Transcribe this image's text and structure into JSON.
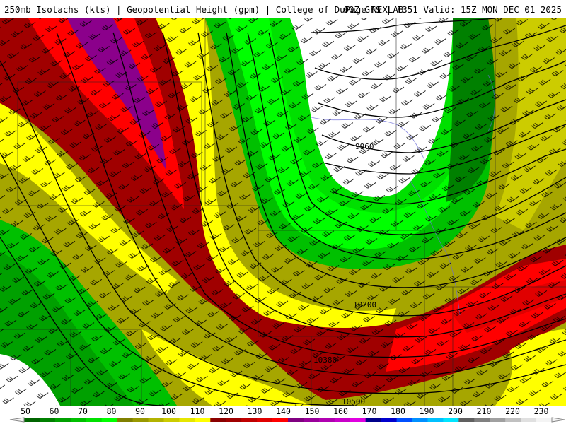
{
  "header": {
    "left": "250mb Isotachs (kts) | Geopotential Height (gpm) | College of DuPage NEXLAB",
    "right": "00Z GFS | F351 Valid: 15Z MON DEC 01 2025"
  },
  "contour_labels": [
    "9960",
    "10200",
    "10380",
    "10500"
  ],
  "legend": {
    "ticks": [
      "50",
      "60",
      "70",
      "80",
      "90",
      "100",
      "110",
      "120",
      "130",
      "140",
      "150",
      "160",
      "170",
      "180",
      "190",
      "200",
      "210",
      "220",
      "230"
    ],
    "colors": [
      "#006400",
      "#008000",
      "#00a000",
      "#00c000",
      "#00e000",
      "#00ff00",
      "#808000",
      "#999900",
      "#b3b300",
      "#cccc00",
      "#e6e600",
      "#ffff00",
      "#8b0000",
      "#a00000",
      "#c00000",
      "#e00000",
      "#ff0000",
      "#800080",
      "#9a009a",
      "#b000b0",
      "#c800c8",
      "#e000e0",
      "#00008b",
      "#0000cd",
      "#0050ff",
      "#0090ff",
      "#00c0ff",
      "#00e5ff",
      "#606060",
      "#808080",
      "#a0a0a0",
      "#c0c0c0",
      "#e0e0e0",
      "#f4f4f4"
    ]
  },
  "palette": {
    "green_dark": "#006400",
    "green": "#00b000",
    "green_light": "#00e000",
    "olive": "#999900",
    "yellow": "#ffff00",
    "darkred": "#a00000",
    "red": "#ff0000",
    "purple": "#8b008b"
  }
}
